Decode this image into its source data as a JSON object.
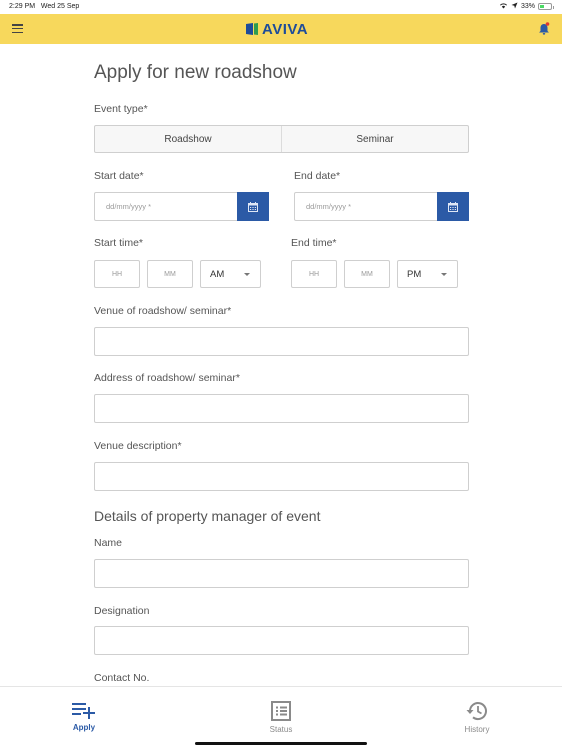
{
  "status_bar": {
    "time": "2:29 PM",
    "date": "Wed 25 Sep",
    "battery": "33%"
  },
  "header": {
    "logo_text": "AVIVA",
    "menu_icon": "hamburger-menu-icon",
    "notification_icon": "bell-icon",
    "brand_color": "#1d4c9a",
    "header_color": "#f7d85c"
  },
  "form": {
    "title": "Apply for new roadshow",
    "event_type": {
      "label": "Event type*",
      "options": [
        "Roadshow",
        "Seminar"
      ]
    },
    "start_date": {
      "label": "Start date*",
      "placeholder": "dd/mm/yyyy *"
    },
    "end_date": {
      "label": "End date*",
      "placeholder": "dd/mm/yyyy *"
    },
    "start_time": {
      "label": "Start time*",
      "hh_placeholder": "HH",
      "mm_placeholder": "MM",
      "period": "AM"
    },
    "end_time": {
      "label": "End time*",
      "hh_placeholder": "HH",
      "mm_placeholder": "MM",
      "period": "PM"
    },
    "venue": {
      "label": "Venue of roadshow/ seminar*",
      "value": ""
    },
    "address": {
      "label": "Address of roadshow/ seminar*",
      "value": ""
    },
    "venue_description": {
      "label": "Venue description*",
      "value": ""
    },
    "manager_section_title": "Details of property manager of event",
    "name": {
      "label": "Name",
      "value": ""
    },
    "designation": {
      "label": "Designation",
      "value": ""
    },
    "contact": {
      "label": "Contact No."
    }
  },
  "tab_bar": {
    "tabs": [
      {
        "label": "Apply",
        "icon": "apply-list-add-icon",
        "active": true
      },
      {
        "label": "Status",
        "icon": "status-list-icon",
        "active": false
      },
      {
        "label": "History",
        "icon": "history-clock-icon",
        "active": false
      }
    ]
  }
}
